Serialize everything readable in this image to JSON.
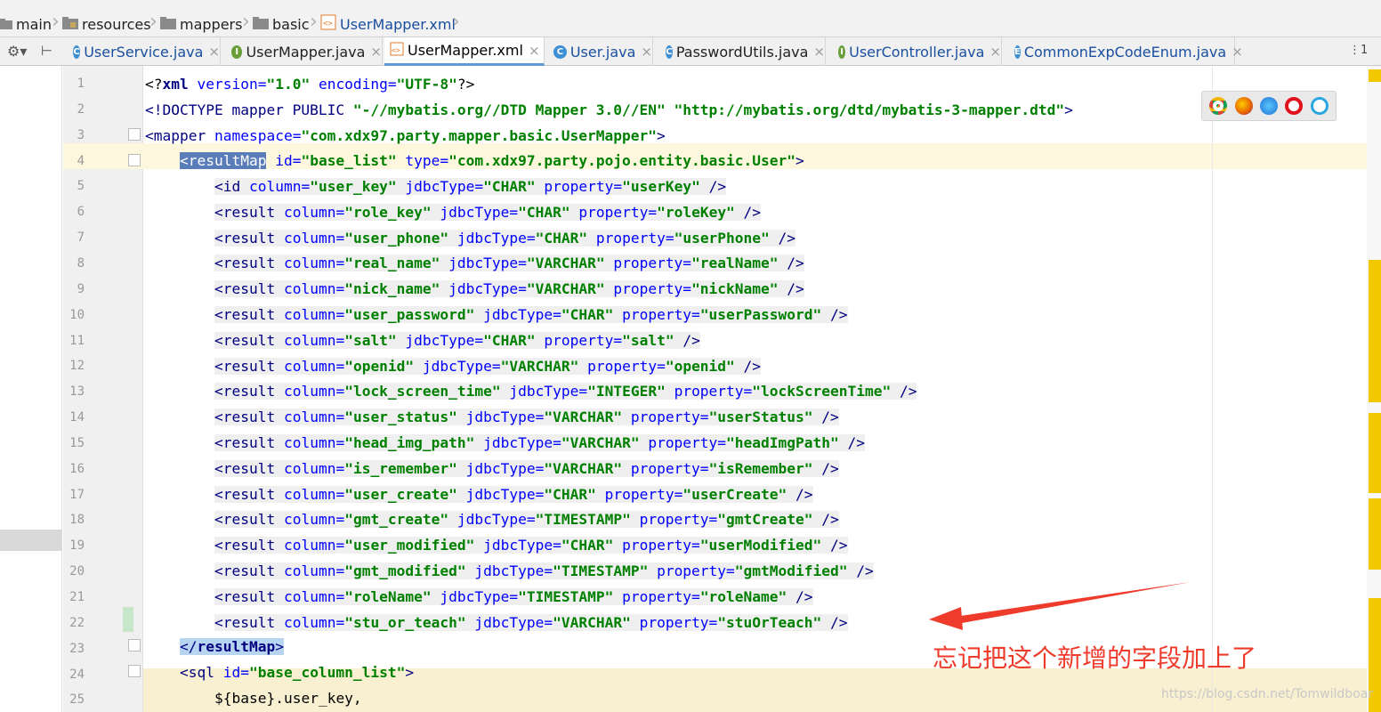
{
  "breadcrumb": {
    "items": [
      {
        "label": "main",
        "icon": "folder-icon"
      },
      {
        "label": "resources",
        "icon": "folder-icon"
      },
      {
        "label": "mappers",
        "icon": "folder-icon"
      },
      {
        "label": "basic",
        "icon": "folder-icon"
      },
      {
        "label": "UserMapper.xml",
        "icon": "xml-file-icon"
      }
    ]
  },
  "tabs": [
    {
      "label": "UserService.java",
      "kind": "C",
      "color": "#3d8fd6"
    },
    {
      "label": "UserMapper.java",
      "kind": "I",
      "color": "#6a9f3a"
    },
    {
      "label": "UserMapper.xml",
      "kind": "xml",
      "color": "#e07b2a"
    },
    {
      "label": "User.java",
      "kind": "C",
      "color": "#3d8fd6"
    },
    {
      "label": "PasswordUtils.java",
      "kind": "C",
      "color": "#3d8fd6"
    },
    {
      "label": "UserController.java",
      "kind": "I",
      "color": "#6a9f3a"
    },
    {
      "label": "CommonExpCodeEnum.java",
      "kind": "E",
      "color": "#3d8fd6"
    }
  ],
  "tab_overflow": "⋮1",
  "code": {
    "line_numbers": [
      "1",
      "2",
      "3",
      "4",
      "5",
      "6",
      "7",
      "8",
      "9",
      "10",
      "11",
      "12",
      "13",
      "14",
      "15",
      "16",
      "17",
      "18",
      "19",
      "20",
      "21",
      "22",
      "23",
      "24",
      "25"
    ],
    "l1": {
      "open": "<?",
      "tag": "xml",
      "a1": " version=",
      "v1": "\"1.0\"",
      "a2": " encoding=",
      "v2": "\"UTF-8\"",
      "close": "?>"
    },
    "l2": {
      "tag": "<!DOCTYPE mapper PUBLIC ",
      "v1": "\"-//mybatis.org//DTD Mapper 3.0//EN\"",
      "sp": " ",
      "v2": "\"http://mybatis.org/dtd/mybatis-3-mapper.dtd\"",
      "close": ">"
    },
    "l3": {
      "tag": "<mapper",
      "a1": " namespace=",
      "v1": "\"com.xdx97.party.mapper.basic.UserMapper\"",
      "close": ">"
    },
    "l4": {
      "tag": "<resultMap",
      "a1": " id=",
      "v1": "\"base_list\"",
      "a2": " type=",
      "v2": "\"com.xdx97.party.pojo.entity.basic.User\"",
      "close": ">"
    },
    "results": [
      {
        "tag": "<id",
        "column": "\"user_key\"",
        "jdbc": "\"CHAR\"",
        "prop": "\"userKey\""
      },
      {
        "tag": "<result",
        "column": "\"role_key\"",
        "jdbc": "\"CHAR\"",
        "prop": "\"roleKey\""
      },
      {
        "tag": "<result",
        "column": "\"user_phone\"",
        "jdbc": "\"CHAR\"",
        "prop": "\"userPhone\""
      },
      {
        "tag": "<result",
        "column": "\"real_name\"",
        "jdbc": "\"VARCHAR\"",
        "prop": "\"realName\""
      },
      {
        "tag": "<result",
        "column": "\"nick_name\"",
        "jdbc": "\"VARCHAR\"",
        "prop": "\"nickName\""
      },
      {
        "tag": "<result",
        "column": "\"user_password\"",
        "jdbc": "\"CHAR\"",
        "prop": "\"userPassword\""
      },
      {
        "tag": "<result",
        "column": "\"salt\"",
        "jdbc": "\"CHAR\"",
        "prop": "\"salt\""
      },
      {
        "tag": "<result",
        "column": "\"openid\"",
        "jdbc": "\"VARCHAR\"",
        "prop": "\"openid\""
      },
      {
        "tag": "<result",
        "column": "\"lock_screen_time\"",
        "jdbc": "\"INTEGER\"",
        "prop": "\"lockScreenTime\""
      },
      {
        "tag": "<result",
        "column": "\"user_status\"",
        "jdbc": "\"VARCHAR\"",
        "prop": "\"userStatus\""
      },
      {
        "tag": "<result",
        "column": "\"head_img_path\"",
        "jdbc": "\"VARCHAR\"",
        "prop": "\"headImgPath\""
      },
      {
        "tag": "<result",
        "column": "\"is_remember\"",
        "jdbc": "\"VARCHAR\"",
        "prop": "\"isRemember\""
      },
      {
        "tag": "<result",
        "column": "\"user_create\"",
        "jdbc": "\"CHAR\"",
        "prop": "\"userCreate\""
      },
      {
        "tag": "<result",
        "column": "\"gmt_create\"",
        "jdbc": "\"TIMESTAMP\"",
        "prop": "\"gmtCreate\""
      },
      {
        "tag": "<result",
        "column": "\"user_modified\"",
        "jdbc": "\"CHAR\"",
        "prop": "\"userModified\""
      },
      {
        "tag": "<result",
        "column": "\"gmt_modified\"",
        "jdbc": "\"TIMESTAMP\"",
        "prop": "\"gmtModified\""
      },
      {
        "tag": "<result",
        "column": "\"roleName\"",
        "jdbc": "\"TIMESTAMP\"",
        "prop": "\"roleName\""
      },
      {
        "tag": "<result",
        "column": "\"stu_or_teach\"",
        "jdbc": "\"VARCHAR\"",
        "prop": "\"stuOrTeach\""
      }
    ],
    "attr_column": " column=",
    "attr_jdbc": " jdbcType=",
    "attr_prop": " property=",
    "self_close": " />",
    "l23": {
      "open": "</",
      "tag": "resultMap",
      "close": ">"
    },
    "l24": {
      "tag": "<sql",
      "a1": " id=",
      "v1": "\"base_column_list\"",
      "close": ">"
    },
    "l25": {
      "text": "${base}.user_key,"
    }
  },
  "annotation_text": "忘记把这个新增的字段加上了",
  "watermark": "https://blog.csdn.net/Tomwildboar",
  "colors": {
    "accent_arrow": "#ef3b2c",
    "scroll_marker": "#f2c800"
  }
}
